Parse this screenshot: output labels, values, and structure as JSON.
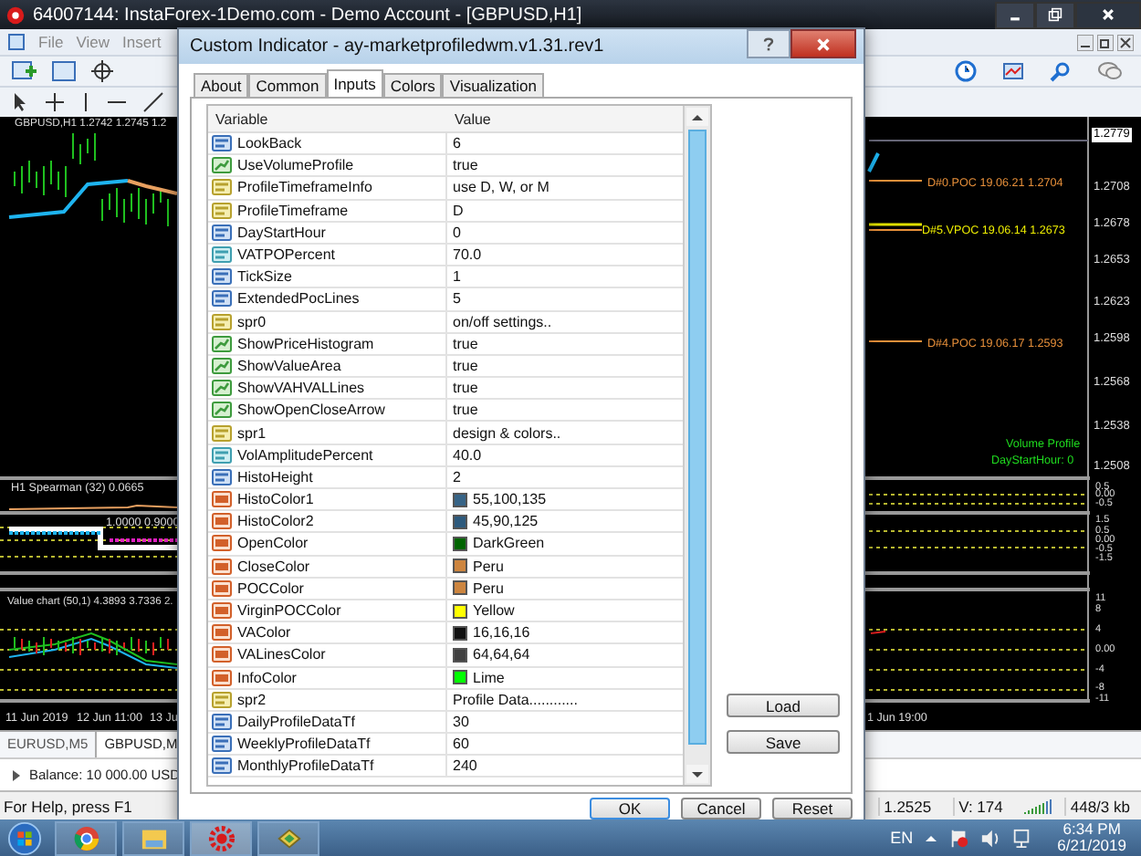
{
  "main_window": {
    "title": "64007144: InstaForex-1Demo.com - Demo Account - [GBPUSD,H1]"
  },
  "menu": [
    "File",
    "View",
    "Insert"
  ],
  "chart": {
    "header": "GBPUSD,H1  1.2742 1.2745 1.2",
    "price_labels": [
      {
        "text": "1.2779",
        "selected": true
      },
      {
        "text": "1.2708",
        "selected": false
      },
      {
        "text": "1.2678",
        "selected": false
      },
      {
        "text": "1.2653",
        "selected": false
      },
      {
        "text": "1.2623",
        "selected": false
      },
      {
        "text": "1.2598",
        "selected": false
      },
      {
        "text": "1.2568",
        "selected": false
      },
      {
        "text": "1.2538",
        "selected": false
      },
      {
        "text": "1.2508",
        "selected": false
      }
    ],
    "poc_labels": [
      {
        "text": "D#0.POC 19.06.21 1.2704",
        "color": "#e8903a"
      },
      {
        "text": "D#5.VPOC 19.06.14 1.2673",
        "color": "#f0f000"
      },
      {
        "text": "D#4.POC 19.06.17 1.2593",
        "color": "#e8903a"
      }
    ],
    "info_lines": [
      "Volume Profile",
      "DayStartHour: 0"
    ],
    "indicator_titles": [
      "H1 Spearman (32) 0.0665",
      "1.0000 0.9000",
      "Value chart (50,1) 4.3893 3.7336 2."
    ],
    "sub_scales": [
      [
        "0.5",
        "0.00",
        "-0.5"
      ],
      [
        "1.5",
        "0.5",
        "0.00",
        "-0.5",
        "-1.5"
      ],
      [
        "11",
        "8",
        "4",
        "0.00",
        "-4",
        "-8",
        "-11"
      ]
    ],
    "time_labels": [
      "11 Jun 2019",
      "12 Jun 11:00",
      "13 Ju",
      "1 Jun 19:00"
    ]
  },
  "chart_tabs": [
    {
      "label": "EURUSD,M5",
      "selected": false
    },
    {
      "label": "GBPUSD,M",
      "selected": true
    }
  ],
  "balance": "Balance: 10 000.00 USD",
  "status_bar": {
    "help": "For Help, press F1",
    "price": "1.2525",
    "volume": "V: 174",
    "traffic": "448/3 kb"
  },
  "dialog": {
    "title": "Custom Indicator - ay-marketprofiledwm.v1.31.rev1",
    "tabs": [
      {
        "label": "About",
        "selected": false
      },
      {
        "label": "Common",
        "selected": false
      },
      {
        "label": "Inputs",
        "selected": true
      },
      {
        "label": "Colors",
        "selected": false
      },
      {
        "label": "Visualization",
        "selected": false
      }
    ],
    "columns": [
      "Variable",
      "Value"
    ],
    "rows": [
      {
        "name": "LookBack",
        "kind": "int",
        "value": "6"
      },
      {
        "name": "UseVolumeProfile",
        "kind": "bool",
        "value": "true"
      },
      {
        "name": "ProfileTimeframeInfo",
        "kind": "string",
        "value": "use D, W, or M"
      },
      {
        "name": "ProfileTimeframe",
        "kind": "string",
        "value": "D"
      },
      {
        "name": "DayStartHour",
        "kind": "int",
        "value": "0"
      },
      {
        "name": "VATPOPercent",
        "kind": "double",
        "value": "70.0"
      },
      {
        "name": "TickSize",
        "kind": "int",
        "value": "1"
      },
      {
        "name": "ExtendedPocLines",
        "kind": "int",
        "value": "5"
      },
      {
        "name": "spr0",
        "kind": "string",
        "value": "on/off settings.."
      },
      {
        "name": "ShowPriceHistogram",
        "kind": "bool",
        "value": "true"
      },
      {
        "name": "ShowValueArea",
        "kind": "bool",
        "value": "true"
      },
      {
        "name": "ShowVAHVALLines",
        "kind": "bool",
        "value": "true"
      },
      {
        "name": "ShowOpenCloseArrow",
        "kind": "bool",
        "value": "true"
      },
      {
        "name": "spr1",
        "kind": "string",
        "value": "design & colors.."
      },
      {
        "name": "VolAmplitudePercent",
        "kind": "double",
        "value": "40.0"
      },
      {
        "name": "HistoHeight",
        "kind": "int",
        "value": "2"
      },
      {
        "name": "HistoColor1",
        "kind": "color",
        "value": "55,100,135",
        "color": "#376487"
      },
      {
        "name": "HistoColor2",
        "kind": "color",
        "value": "45,90,125",
        "color": "#2d5a7d"
      },
      {
        "name": "OpenColor",
        "kind": "color",
        "value": "DarkGreen",
        "color": "#006400"
      },
      {
        "name": "CloseColor",
        "kind": "color",
        "value": "Peru",
        "color": "#cd853f"
      },
      {
        "name": "POCColor",
        "kind": "color",
        "value": "Peru",
        "color": "#cd853f"
      },
      {
        "name": "VirginPOCColor",
        "kind": "color",
        "value": "Yellow",
        "color": "#ffff00"
      },
      {
        "name": "VAColor",
        "kind": "color",
        "value": "16,16,16",
        "color": "#101010"
      },
      {
        "name": "VALinesColor",
        "kind": "color",
        "value": "64,64,64",
        "color": "#404040"
      },
      {
        "name": "InfoColor",
        "kind": "color",
        "value": "Lime",
        "color": "#00ff00"
      },
      {
        "name": "spr2",
        "kind": "string",
        "value": "Profile Data............"
      },
      {
        "name": "DailyProfileDataTf",
        "kind": "int",
        "value": "30"
      },
      {
        "name": "WeeklyProfileDataTf",
        "kind": "int",
        "value": "60"
      },
      {
        "name": "MonthlyProfileDataTf",
        "kind": "int",
        "value": "240"
      }
    ],
    "side_buttons": [
      "Load",
      "Save"
    ],
    "buttons": [
      "OK",
      "Cancel",
      "Reset"
    ]
  },
  "taskbar": {
    "language": "EN",
    "time": "6:34 PM",
    "date": "6/21/2019"
  }
}
